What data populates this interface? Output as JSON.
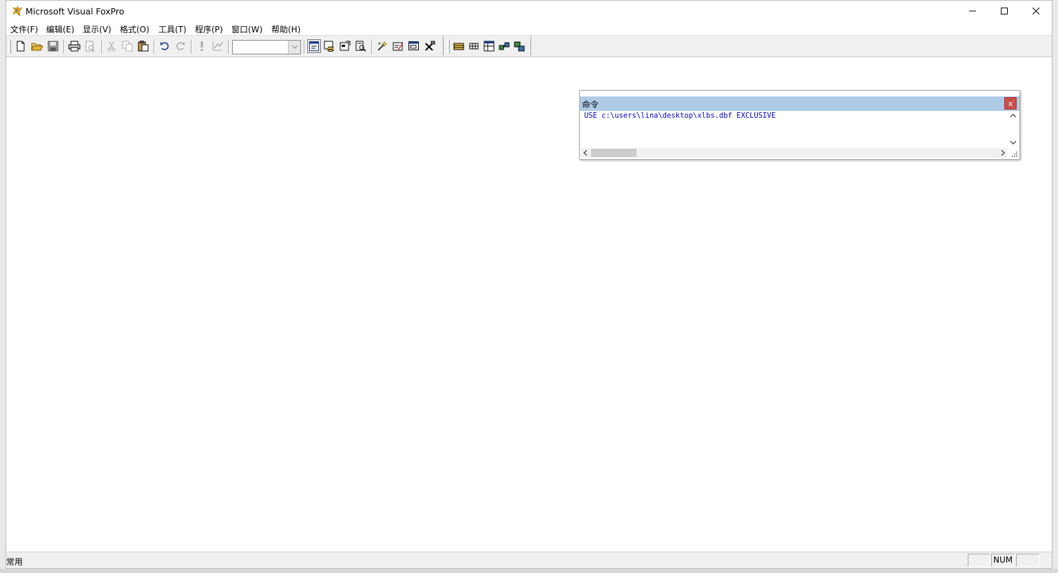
{
  "window": {
    "title": "Microsoft Visual FoxPro"
  },
  "menu": {
    "items": [
      "文件(F)",
      "编辑(E)",
      "显示(V)",
      "格式(O)",
      "工具(T)",
      "程序(P)",
      "窗口(W)",
      "帮助(H)"
    ]
  },
  "toolbar": {
    "combo_value": ""
  },
  "command_window": {
    "title": "命令",
    "close_label": "x",
    "lines": [
      "USE c:\\users\\lina\\desktop\\xlbs.dbf EXCLUSIVE"
    ]
  },
  "status_bar": {
    "text": "常用",
    "num_indicator": "NUM"
  }
}
